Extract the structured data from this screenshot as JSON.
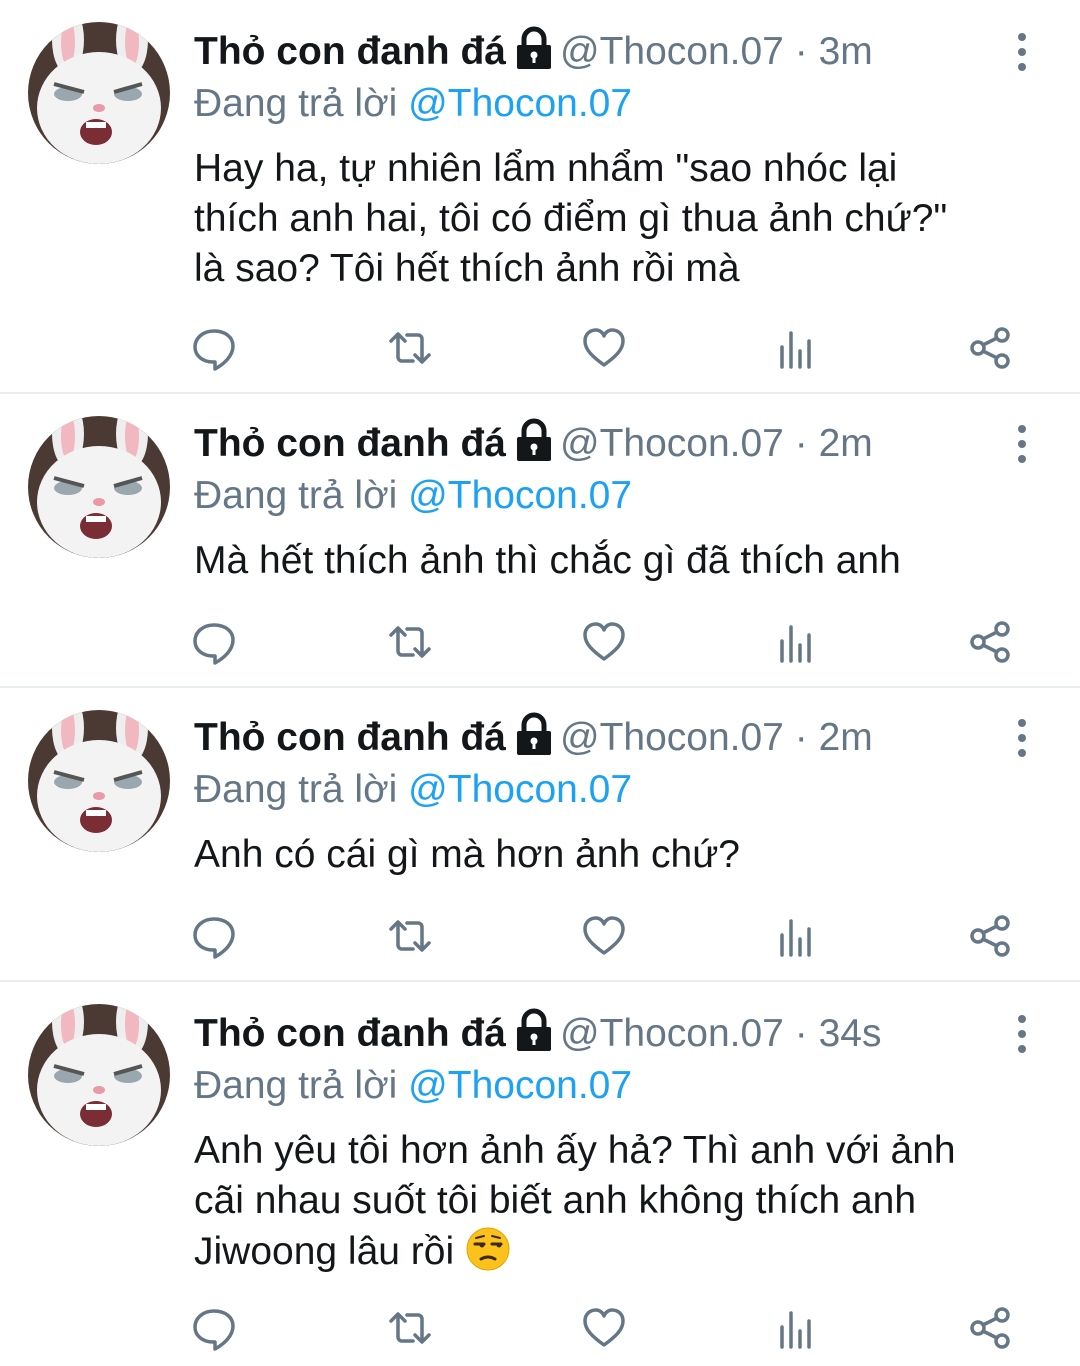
{
  "tweets": [
    {
      "name": "Thỏ con đanh đá",
      "handle": "@Thocon.07",
      "sep": "·",
      "time": "3m",
      "reply_prefix": "Đang trả lời",
      "reply_to": "@Thocon.07",
      "lines": [
        "Hay ha, tự nhiên lẩm nhẩm \"sao nhóc lại",
        "thích anh hai, tôi có điểm gì thua ảnh chứ?\"",
        "là sao? Tôi hết thích ảnh rồi mà"
      ]
    },
    {
      "name": "Thỏ con đanh đá",
      "handle": "@Thocon.07",
      "sep": "·",
      "time": "2m",
      "reply_prefix": "Đang trả lời",
      "reply_to": "@Thocon.07",
      "lines": [
        "Mà hết thích ảnh thì chắc gì đã thích anh"
      ]
    },
    {
      "name": "Thỏ con đanh đá",
      "handle": "@Thocon.07",
      "sep": "·",
      "time": "2m",
      "reply_prefix": "Đang trả lời",
      "reply_to": "@Thocon.07",
      "lines": [
        "Anh có cái gì mà hơn ảnh chứ?"
      ]
    },
    {
      "name": "Thỏ con đanh đá",
      "handle": "@Thocon.07",
      "sep": "·",
      "time": "34s",
      "reply_prefix": "Đang trả lời",
      "reply_to": "@Thocon.07",
      "lines": [
        "Anh yêu tôi hơn ảnh ấy hả? Thì anh với ảnh",
        "cãi nhau suốt tôi biết anh không thích anh",
        "Jiwoong lâu rồi"
      ],
      "emoji": "unamused-face-emoji"
    }
  ],
  "icons": {
    "avatar": "white-rabbit-avatar",
    "lock": "lock-icon",
    "more": "more-vertical-icon",
    "reply": "reply-icon",
    "retweet": "retweet-icon",
    "like": "heart-icon",
    "analytics": "analytics-icon",
    "share": "share-icon"
  },
  "colors": {
    "text": "#14171a",
    "secondary": "#657786",
    "accent": "#1da1f2",
    "divider": "#e6ecf0"
  }
}
